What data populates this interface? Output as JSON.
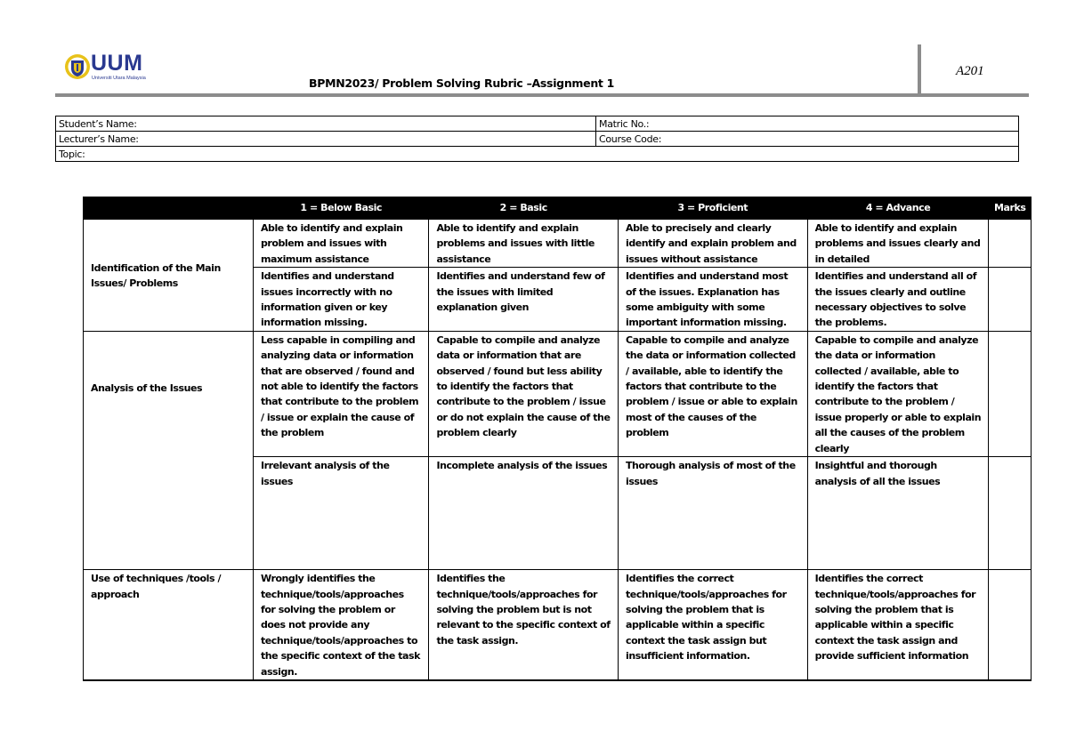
{
  "header": {
    "logo": {
      "name": "UUM",
      "subtitle": "Universiti Utara Malaysia",
      "colors": {
        "blue": "#2a3990",
        "gold": "#e8c21a"
      }
    },
    "title": "BPMN2023/ Problem Solving Rubric –Assignment 1",
    "code": "A201"
  },
  "info_fields": {
    "student_name": "Student’s Name:",
    "matric_no": "Matric No.:",
    "lecturer_name": "Lecturer’s Name:",
    "course_code": "Course Code:",
    "topic": "Topic:"
  },
  "rubric": {
    "columns": [
      "",
      "1 = Below Basic",
      "2 = Basic",
      "3 = Proficient",
      "4 = Advance",
      "Marks"
    ],
    "criteria": [
      {
        "name": "Identification of the Main Issues/ Problems",
        "rows": [
          [
            "Able to identify and explain problem and issues with maximum assistance",
            "Able to identify and explain problems and issues with little assistance",
            "Able to precisely and clearly identify and explain problem and issues without assistance",
            "Able to identify and explain problems and issues clearly and in detailed"
          ],
          [
            "Identifies and understand issues incorrectly with no information given or key information missing.",
            "Identifies and understand few of the issues with limited explanation given",
            "Identifies and understand most of the issues. Explanation has some ambiguity with some important information missing.",
            "Identifies and understand all of the issues clearly and outline necessary objectives to solve the problems."
          ]
        ]
      },
      {
        "name": "Analysis of the Issues",
        "rows": [
          [
            "Less capable in compiling and analyzing data or information that are observed / found and not able to identify the factors that contribute to the problem / issue or explain the cause of the problem",
            "Capable to compile and analyze data or information that are observed / found but less ability to identify the factors that contribute to the problem / issue or do not explain the cause of the problem clearly",
            "Capable to compile and analyze the data or information collected / available, able to identify the factors that contribute to the problem / issue or able to explain most of the causes of the problem",
            "Capable to compile and analyze the data or information collected / available, able to identify the factors that contribute to the problem / issue properly or able to explain all the causes of the problem clearly"
          ],
          [
            "Irrelevant analysis of the issues",
            "Incomplete analysis of the issues",
            "Thorough analysis of most of the issues",
            "Insightful and thorough analysis of all the issues"
          ]
        ]
      },
      {
        "name": "Use of techniques /tools / approach",
        "rows": [
          [
            "Wrongly identifies the technique/tools/approaches for solving the problem or does not provide any technique/tools/approaches to the specific context of the task assign.",
            "Identifies the technique/tools/approaches for solving the problem but is not relevant to the specific context of the task assign.",
            "Identifies the correct technique/tools/approaches for solving the problem that is applicable within a specific context the task assign but insufficient information.",
            "Identifies the correct technique/tools/approaches for solving the problem that is applicable within a specific context the task assign and provide sufficient information"
          ]
        ]
      }
    ],
    "marks": [
      "",
      "",
      "",
      "",
      ""
    ]
  }
}
